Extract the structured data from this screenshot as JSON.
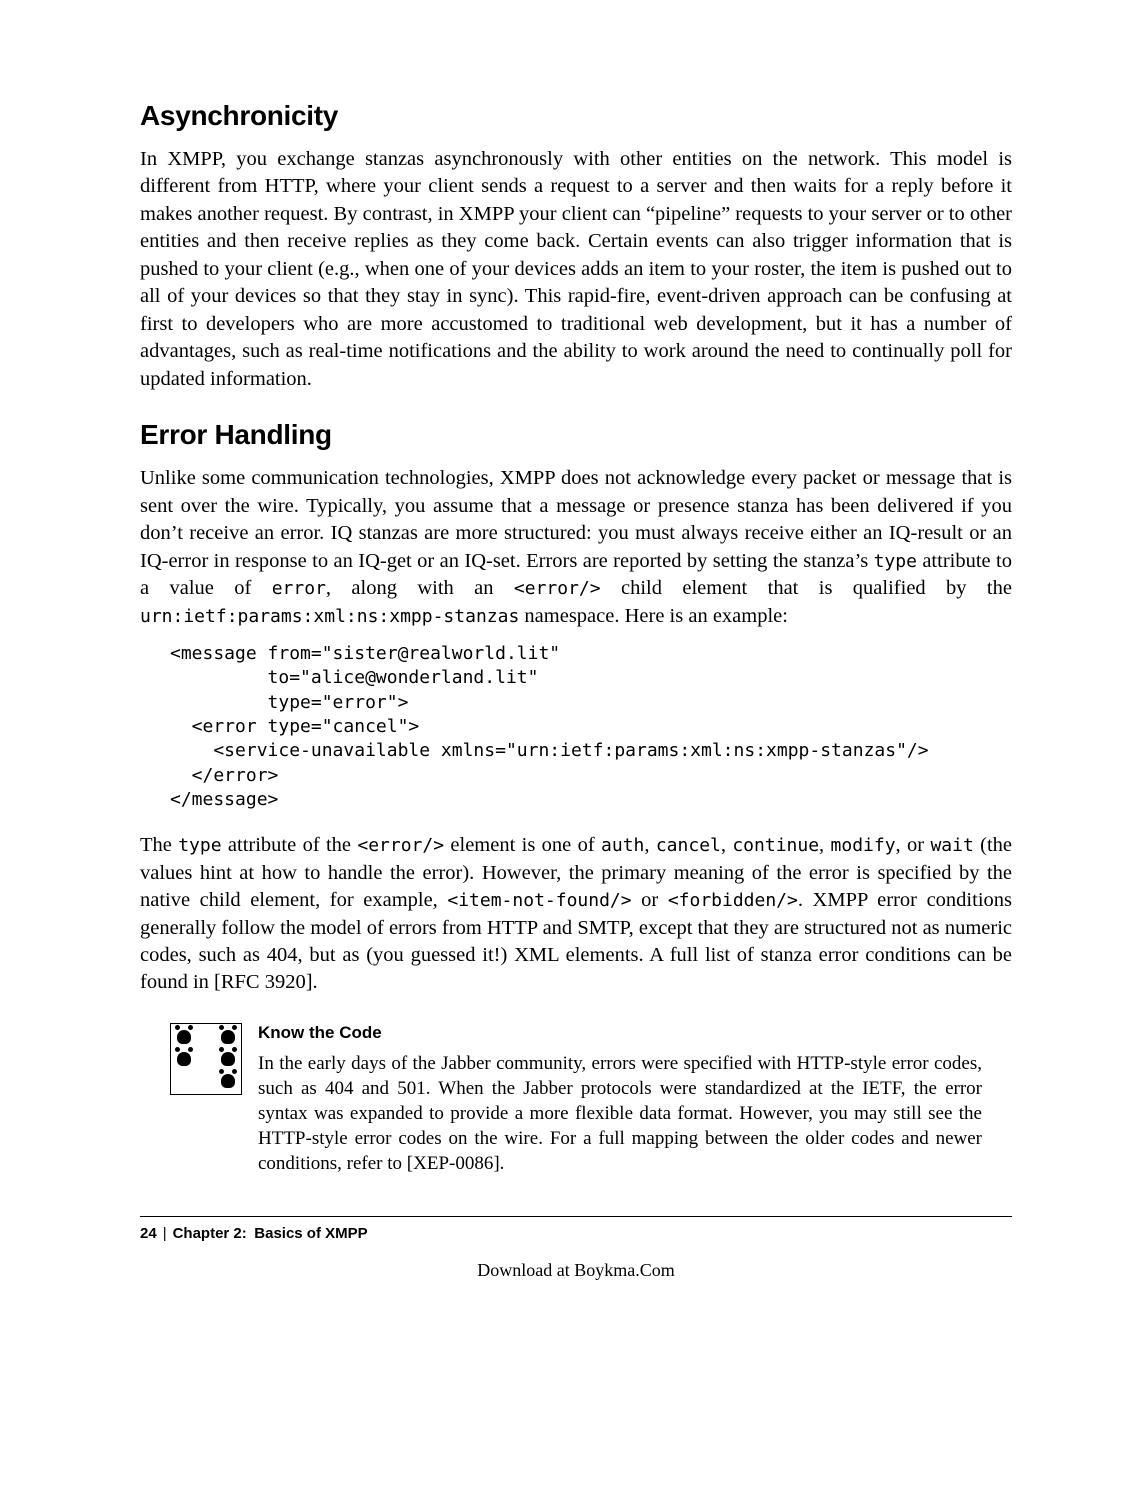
{
  "section1": {
    "heading": "Asynchronicity",
    "para": "In XMPP, you exchange stanzas asynchronously with other entities on the network. This model is different from HTTP, where your client sends a request to a server and then waits for a reply before it makes another request. By contrast, in XMPP your client can “pipeline” requests to your server or to other entities and then receive replies as they come back. Certain events can also trigger information that is pushed to your client (e.g., when one of your devices adds an item to your roster, the item is pushed out to all of your devices so that they stay in sync). This rapid-fire, event-driven approach can be confusing at first to developers who are more accustomed to traditional web development, but it has a number of advantages, such as real-time notifications and the ability to work around the need to continually poll for updated information."
  },
  "section2": {
    "heading": "Error Handling",
    "para1_a": "Unlike some communication technologies, XMPP does not acknowledge every packet or message that is sent over the wire. Typically, you assume that a message or presence stanza has been delivered if you don’t receive an error. IQ stanzas are more structured: you must always receive either an IQ-result or an IQ-error in response to an IQ-get or an IQ-set. Errors are reported by setting the stanza’s ",
    "code_type": "type",
    "para1_b": " attribute to a value of ",
    "code_error": "error",
    "para1_c": ", along with an ",
    "code_error_el": "<error/>",
    "para1_d": " child element that is qualified by the ",
    "code_ns": "urn:ietf:params:xml:ns:xmpp-stanzas",
    "para1_e": " namespace. Here is an example:",
    "codeblock": "<message from=\"sister@realworld.lit\"\n         to=\"alice@wonderland.lit\"\n         type=\"error\">\n  <error type=\"cancel\">\n    <service-unavailable xmlns=\"urn:ietf:params:xml:ns:xmpp-stanzas\"/>\n  </error>\n</message>",
    "para2_a": "The ",
    "p2_type": "type",
    "para2_b": " attribute of the ",
    "p2_error_el": "<error/>",
    "para2_c": " element is one of ",
    "p2_auth": "auth",
    "p2_sep": ", ",
    "p2_cancel": "cancel",
    "p2_continue": "continue",
    "p2_modify": "modify",
    "p2_or": ", or ",
    "p2_wait": "wait",
    "para2_d": " (the values hint at how to handle the error). However, the primary meaning of the error is specified by the native child element, for example, ",
    "p2_itemnf": "<item-not-found/>",
    "p2_or2": " or ",
    "p2_forbidden": "<forbidden/>",
    "para2_e": ". XMPP error conditions generally follow the model of errors from HTTP and SMTP, except that they are structured not as numeric codes, such as 404, but as (you guessed it!) XML elements. A full list of stanza error conditions can be found in [RFC 3920]."
  },
  "note": {
    "title": "Know the Code",
    "body": "In the early days of the Jabber community, errors were specified with HTTP-style error codes, such as 404 and 501. When the Jabber protocols were standardized at the IETF, the error syntax was expanded to provide a more flexible data format. However, you may still see the HTTP-style error codes on the wire. For a full mapping between the older codes and newer conditions, refer to [XEP-0086]."
  },
  "footer": {
    "page": "24",
    "chapter": "Chapter 2: Basics of XMPP"
  },
  "download": "Download at Boykma.Com"
}
